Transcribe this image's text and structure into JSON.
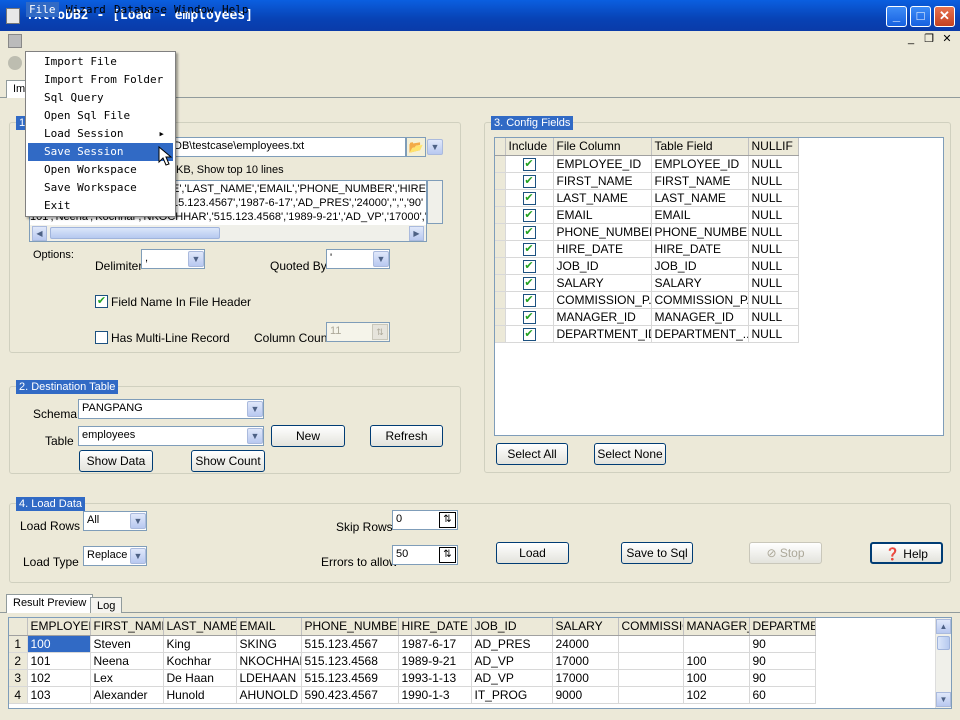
{
  "window": {
    "title": "TxtToDB2 - [Load - employees]"
  },
  "menu": {
    "items": [
      "File",
      "Wizard",
      "Database",
      "Window",
      "Help"
    ],
    "file_dropdown": [
      "Import File",
      "Import From Folder",
      "Sql Query",
      "Open Sql File",
      "Load Session",
      "Save Session",
      "Open Workspace",
      "Save Workspace",
      "Exit"
    ],
    "highlighted": "Save Session"
  },
  "tabs": {
    "import_tab": "Im"
  },
  "source": {
    "group_title": "1",
    "file_path": "DB\\testcase\\employees.txt",
    "file_info": "KB,  Show top 10 lines",
    "preview_lines": [
      "E','LAST_NAME','EMAIL','PHONE_NUMBER','HIRE",
      "15.123.4567','1987-6-17','AD_PRES','24000','','','90'",
      "101','Neena','Kochhar','NKOCHHAR','515.123.4568','1989-9-21','AD_VP','17000','"
    ],
    "options_label": "Options:",
    "delimiter_label": "Delimiter",
    "delimiter_value": ",",
    "quoted_by_label": "Quoted By",
    "quoted_by_value": "'",
    "field_name_header_label": "Field Name In File Header",
    "multiline_label": "Has Multi-Line Record",
    "column_count_label": "Column Count",
    "column_count_value": "11"
  },
  "destination": {
    "group_title": "2. Destination Table",
    "schema_label": "Schema",
    "schema_value": "PANGPANG",
    "table_label": "Table",
    "table_value": "employees",
    "new_button": "New",
    "refresh_button": "Refresh",
    "show_data_button": "Show Data",
    "show_count_button": "Show Count"
  },
  "config": {
    "group_title": "3. Config Fields",
    "columns": [
      "Include",
      "File Column",
      "Table Field",
      "NULLIF"
    ],
    "rows": [
      [
        "EMPLOYEE_ID",
        "EMPLOYEE_ID",
        "NULL"
      ],
      [
        "FIRST_NAME",
        "FIRST_NAME",
        "NULL"
      ],
      [
        "LAST_NAME",
        "LAST_NAME",
        "NULL"
      ],
      [
        "EMAIL",
        "EMAIL",
        "NULL"
      ],
      [
        "PHONE_NUMBER",
        "PHONE_NUMBER",
        "NULL"
      ],
      [
        "HIRE_DATE",
        "HIRE_DATE",
        "NULL"
      ],
      [
        "JOB_ID",
        "JOB_ID",
        "NULL"
      ],
      [
        "SALARY",
        "SALARY",
        "NULL"
      ],
      [
        "COMMISSION_P...",
        "COMMISSION_P...",
        "NULL"
      ],
      [
        "MANAGER_ID",
        "MANAGER_ID",
        "NULL"
      ],
      [
        "DEPARTMENT_ID",
        "DEPARTMENT_...",
        "NULL"
      ]
    ],
    "select_all_button": "Select All",
    "select_none_button": "Select None"
  },
  "load": {
    "group_title": "4. Load Data",
    "load_rows_label": "Load Rows",
    "load_rows_value": "All",
    "load_type_label": "Load Type",
    "load_type_value": "Replace",
    "skip_rows_label": "Skip Rows",
    "skip_rows_value": "0",
    "errors_label": "Errors to allow",
    "errors_value": "50",
    "load_button": "Load",
    "save_sql_button": "Save to Sql",
    "stop_button": "Stop",
    "help_button": "Help"
  },
  "results": {
    "tabs": [
      "Result Preview",
      "Log"
    ],
    "columns": [
      "EMPLOYEE_",
      "FIRST_NAME",
      "LAST_NAME",
      "EMAIL",
      "PHONE_NUMBER",
      "HIRE_DATE",
      "JOB_ID",
      "SALARY",
      "COMMISSIO",
      "MANAGER_I",
      "DEPARTME"
    ],
    "rows": [
      [
        "1",
        "100",
        "Steven",
        "King",
        "SKING",
        "515.123.4567",
        "1987-6-17",
        "AD_PRES",
        "24000",
        "",
        "",
        "90"
      ],
      [
        "2",
        "101",
        "Neena",
        "Kochhar",
        "NKOCHHAR",
        "515.123.4568",
        "1989-9-21",
        "AD_VP",
        "17000",
        "",
        "100",
        "90"
      ],
      [
        "3",
        "102",
        "Lex",
        "De Haan",
        "LDEHAAN",
        "515.123.4569",
        "1993-1-13",
        "AD_VP",
        "17000",
        "",
        "100",
        "90"
      ],
      [
        "4",
        "103",
        "Alexander",
        "Hunold",
        "AHUNOLD",
        "590.423.4567",
        "1990-1-3",
        "IT_PROG",
        "9000",
        "",
        "102",
        "60"
      ]
    ]
  }
}
